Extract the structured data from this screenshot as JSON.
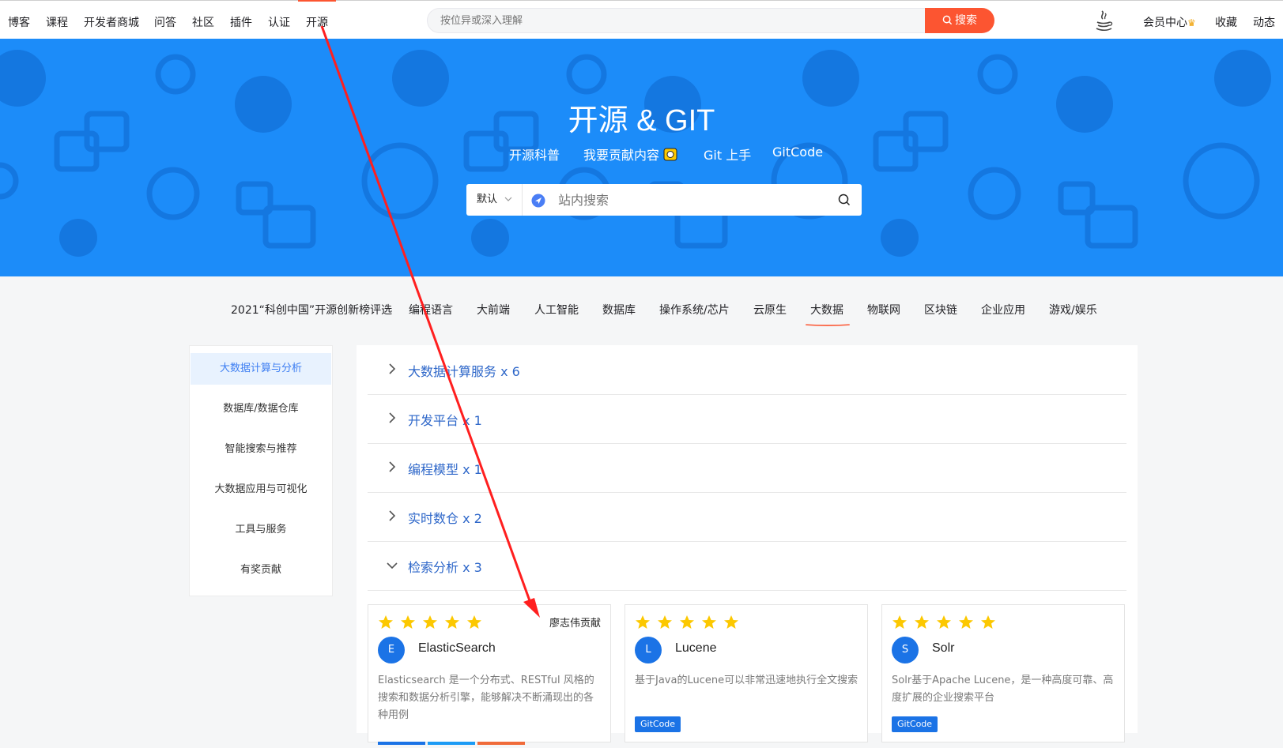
{
  "topnav": {
    "items": [
      "博客",
      "课程",
      "开发者商城",
      "问答",
      "社区",
      "插件",
      "认证",
      "开源"
    ],
    "active_index": 7,
    "search_placeholder": "按位异或深入理解",
    "search_button": "搜索",
    "right_items": [
      "会员中心",
      "收藏",
      "动态"
    ],
    "member_crown": "♛"
  },
  "banner": {
    "title": "开源 & GIT",
    "links": [
      "开源科普",
      "我要贡献内容",
      "Git 上手",
      "GitCode"
    ],
    "search_select": "默认",
    "search_placeholder": "站内搜索"
  },
  "categories": {
    "tabs": [
      "2021“科创中国”开源创新榜评选",
      "编程语言",
      "大前端",
      "人工智能",
      "数据库",
      "操作系统/芯片",
      "云原生",
      "大数据",
      "物联网",
      "区块链",
      "企业应用",
      "游戏/娱乐"
    ],
    "active_index": 7
  },
  "sidebar": {
    "items": [
      "大数据计算与分析",
      "数据库/数据仓库",
      "智能搜索与推荐",
      "大数据应用与可视化",
      "工具与服务",
      "有奖贡献"
    ],
    "active_index": 0
  },
  "accordion": [
    {
      "label": "大数据计算服务 x 6",
      "expanded": false
    },
    {
      "label": "开发平台 x 1",
      "expanded": false
    },
    {
      "label": "编程模型 x 1",
      "expanded": false
    },
    {
      "label": "实时数仓 x 2",
      "expanded": false
    },
    {
      "label": "检索分析 x 3",
      "expanded": true
    }
  ],
  "cards": [
    {
      "rating": 5,
      "contributor": "廖志伟贡献",
      "avatar": "E",
      "name": "ElasticSearch",
      "description": "Elasticsearch 是一个分布式、RESTful 风格的搜索和数据分析引擎，能够解决不断涌现出的各种用例",
      "tag": ""
    },
    {
      "rating": 5,
      "contributor": "",
      "avatar": "L",
      "name": "Lucene",
      "description": "基于Java的Lucene可以非常迅速地执行全文搜索",
      "tag": "GitCode"
    },
    {
      "rating": 5,
      "contributor": "",
      "avatar": "S",
      "name": "Solr",
      "description": "Solr基于Apache Lucene，是一种高度可靠、高度扩展的企业搜索平台",
      "tag": "GitCode"
    }
  ],
  "colors": {
    "accent": "#fc5531",
    "banner": "#1c8cf9",
    "link": "#2e67c9",
    "star": "#fcc800",
    "avatar": "#1b73e6",
    "annotation_arrow": "#ff1f1f"
  }
}
